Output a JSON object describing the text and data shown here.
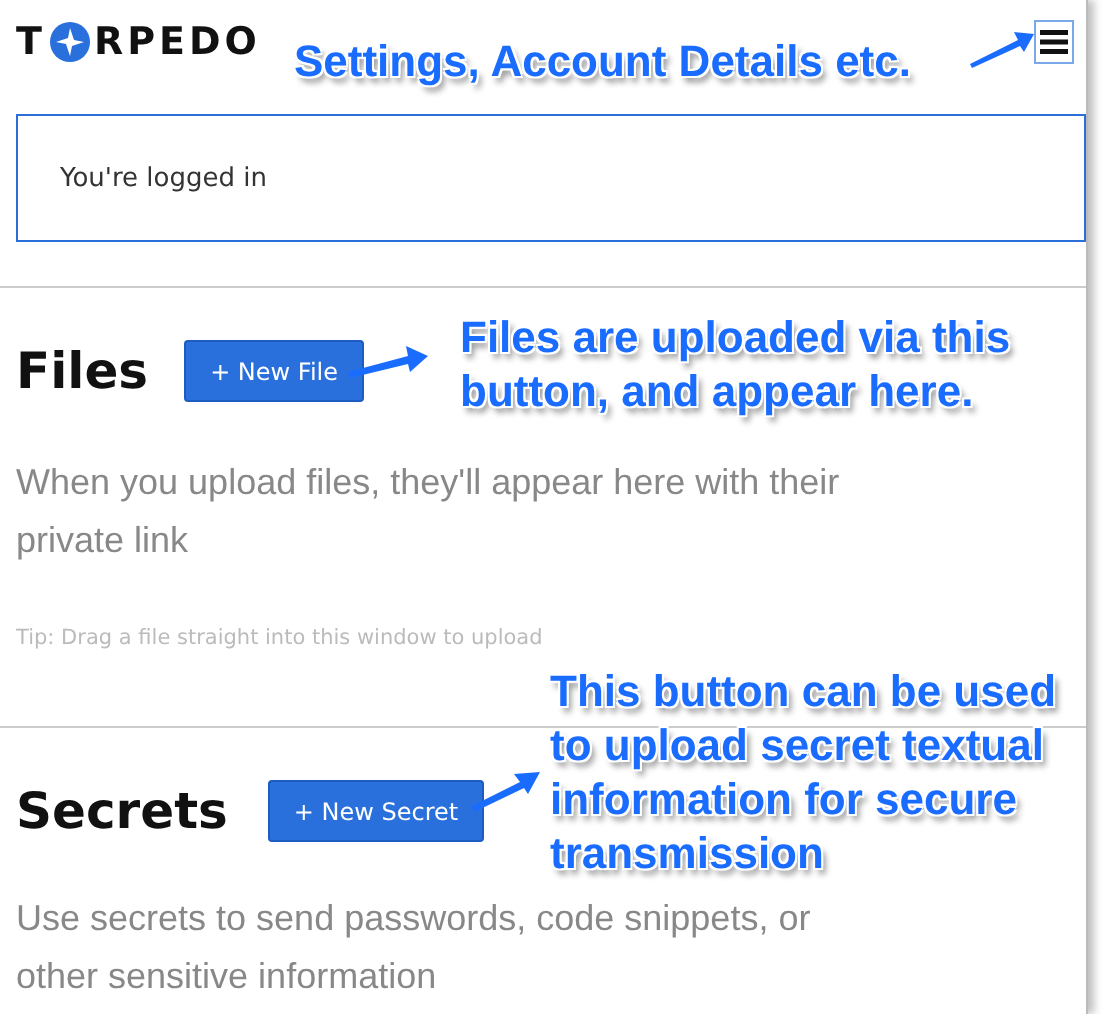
{
  "header": {
    "logo": {
      "before": "T",
      "after": "RPEDO"
    }
  },
  "login_notice": "You're logged in",
  "sections": [
    {
      "heading": "Files",
      "button": "+ New File",
      "description": "When you upload files, they'll appear here with their private link",
      "tip": "Tip: Drag a file straight into this window to upload"
    },
    {
      "heading": "Secrets",
      "button": "+ New Secret",
      "description": "Use secrets to send passwords, code snippets, or other sensitive information"
    }
  ],
  "annotations": [
    {
      "text": "Settings, Account Details etc."
    },
    {
      "text": "Files are uploaded via this button, and appear here."
    },
    {
      "text": "This button can be used to upload secret textual information for secure transmission"
    }
  ]
}
